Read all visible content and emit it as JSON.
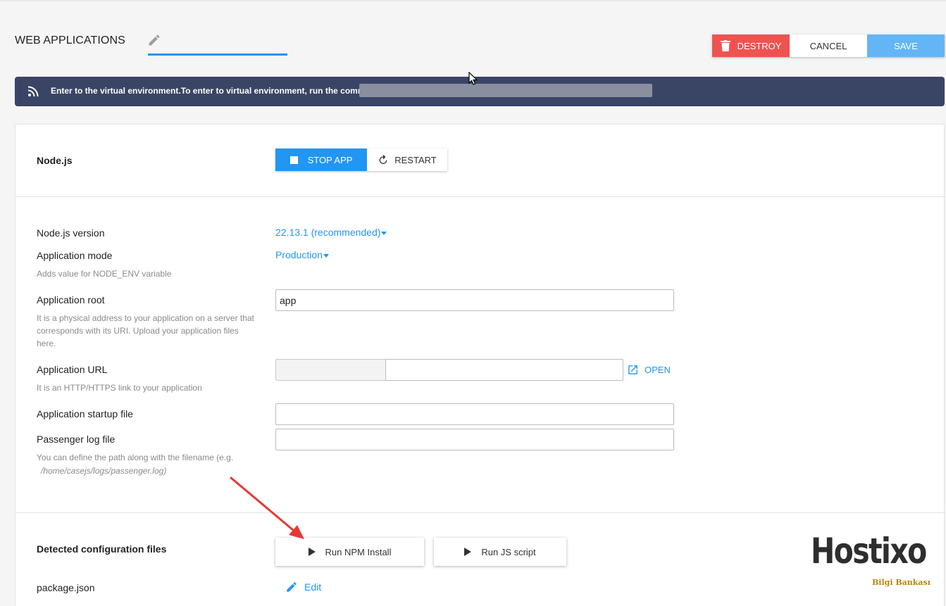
{
  "header": {
    "title": "WEB APPLICATIONS",
    "name_value": "",
    "buttons": {
      "destroy": "DESTROY",
      "cancel": "CANCEL",
      "save": "SAVE"
    }
  },
  "banner": {
    "message": "Enter to the virtual environment.To enter to virtual environment, run the command:",
    "icon": "rss-icon"
  },
  "runtime": {
    "label": "Node.js",
    "stop_label": "STOP APP",
    "restart_label": "RESTART"
  },
  "settings": {
    "version": {
      "label": "Node.js version",
      "value": "22.13.1 (recommended)"
    },
    "mode": {
      "label": "Application mode",
      "value": "Production",
      "hint": "Adds value for NODE_ENV variable"
    },
    "root": {
      "label": "Application root",
      "value": "app",
      "hint": "It is a physical address to your application on a server that corresponds with its URI. Upload your application files here."
    },
    "url": {
      "label": "Application URL",
      "value": "",
      "hint": "It is an HTTP/HTTPS link to your application",
      "open_label": "OPEN"
    },
    "startup": {
      "label": "Application startup file",
      "value": ""
    },
    "log": {
      "label": "Passenger log file",
      "value": "",
      "hint_prefix": "You can define the path along with the filename (e.g.",
      "hint_path": "/home/casejs/logs/passenger.log)"
    }
  },
  "config": {
    "label": "Detected configuration files",
    "npm_label": "Run NPM Install",
    "js_label": "Run JS script",
    "file_label": "package.json",
    "edit_label": "Edit"
  },
  "logo": {
    "word": "Hostixo",
    "sub": "Bilgi Bankası"
  },
  "colors": {
    "primary": "#2196f3",
    "danger": "#ef5350",
    "save": "#64b5f6",
    "banner": "#3a4566"
  }
}
